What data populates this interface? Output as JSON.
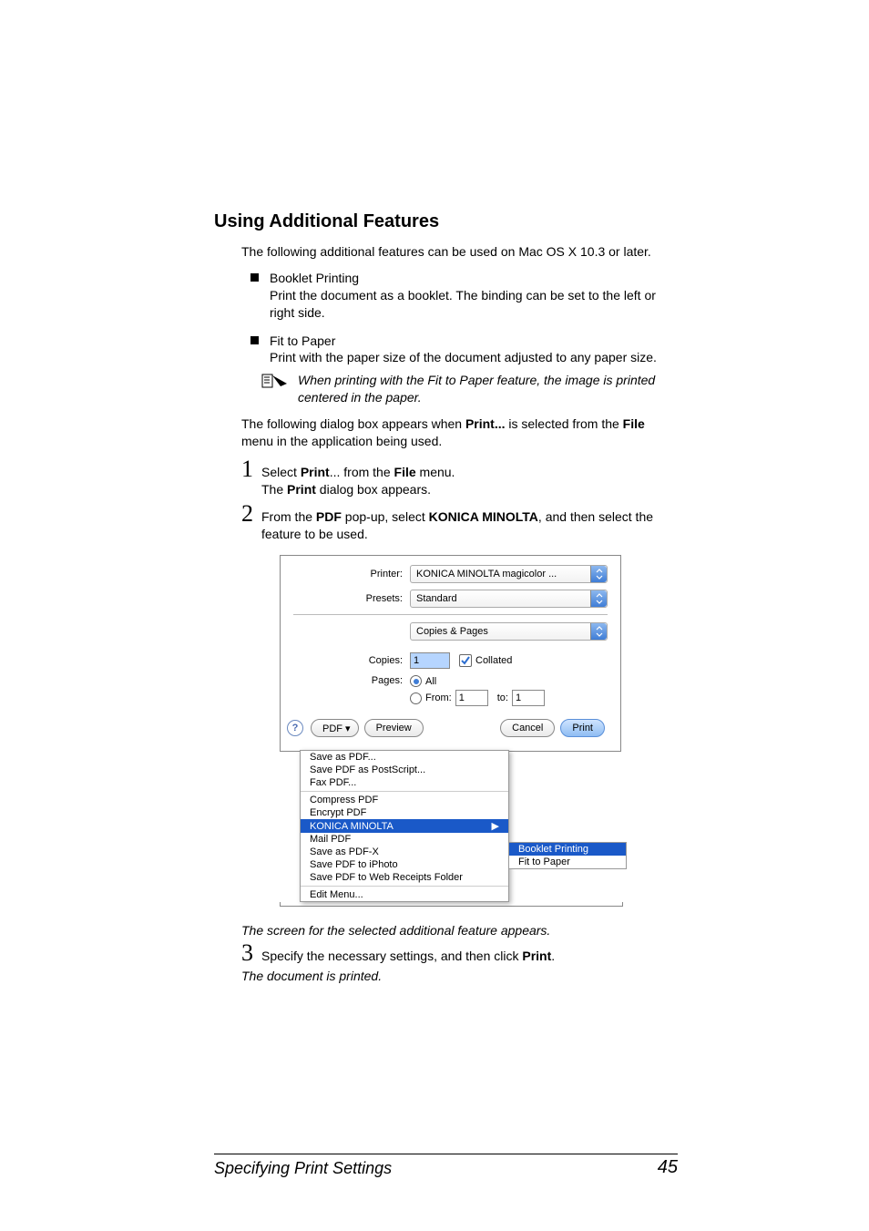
{
  "heading": "Using Additional Features",
  "intro": "The following additional features can be used on Mac OS X 10.3 or later.",
  "bullets": [
    {
      "title": "Booklet Printing",
      "desc": "Print the document as a booklet. The binding can be set to the left or right side."
    },
    {
      "title": "Fit to Paper",
      "desc": "Print with the paper size of the document adjusted to any paper size."
    }
  ],
  "note": "When printing with the Fit to Paper feature, the image is printed centered in the paper.",
  "transition_pre": "The following dialog box appears when ",
  "transition_bold1": "Print...",
  "transition_mid": " is selected from the ",
  "transition_bold2": "File",
  "transition_post": " menu in the application being used.",
  "step1": {
    "pre": "Select ",
    "b1": "Print",
    "mid1": "... from the ",
    "b2": "File",
    "mid2": " menu.",
    "line2_pre": "The ",
    "line2_b": "Print",
    "line2_post": " dialog box appears."
  },
  "step2": {
    "pre": "From the ",
    "b1": "PDF",
    "mid1": " pop-up, select ",
    "b2": "KONICA MINOLTA",
    "post": ", and then select the feature to be used."
  },
  "dialog": {
    "printer_label": "Printer:",
    "printer_value": "KONICA MINOLTA magicolor ...",
    "presets_label": "Presets:",
    "presets_value": "Standard",
    "section_value": "Copies & Pages",
    "copies_label": "Copies:",
    "copies_value": "1",
    "collated_label": "Collated",
    "pages_label": "Pages:",
    "all_label": "All",
    "from_label": "From:",
    "from_value": "1",
    "to_label": "to:",
    "to_value": "1",
    "help": "?",
    "pdf_btn": "PDF ▾",
    "preview_btn": "Preview",
    "cancel_btn": "Cancel",
    "print_btn": "Print",
    "menu": {
      "g1": [
        "Save as PDF...",
        "Save PDF as PostScript...",
        "Fax PDF..."
      ],
      "g2": [
        "Compress PDF",
        "Encrypt PDF"
      ],
      "hl": "KONICA MINOLTA",
      "g3": [
        "Mail PDF",
        "Save as PDF-X",
        "Save PDF to iPhoto",
        "Save PDF to Web Receipts Folder"
      ],
      "g4": [
        "Edit Menu..."
      ]
    },
    "submenu": {
      "hl": "Booklet Printing",
      "item": "Fit to Paper"
    }
  },
  "after_dialog_italic": "The screen for the selected additional feature appears.",
  "step3": {
    "pre": "Specify the necessary settings, and then click ",
    "b": "Print",
    "post": "."
  },
  "final_italic": "The document is printed.",
  "footer": {
    "left": "Specifying Print Settings",
    "right": "45"
  }
}
